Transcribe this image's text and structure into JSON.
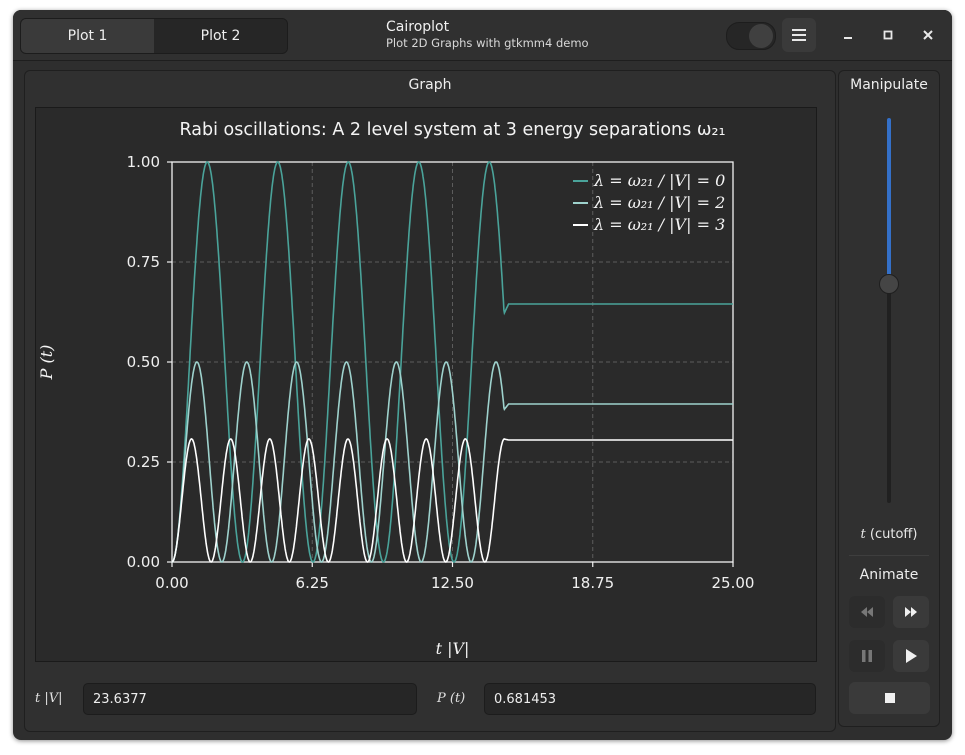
{
  "header": {
    "tabs": [
      {
        "label": "Plot 1"
      },
      {
        "label": "Plot 2"
      }
    ],
    "app_title": "Cairoplot",
    "app_subtitle": "Plot 2D Graphs with gtkmm4 demo"
  },
  "graph_panel": {
    "title": "Graph"
  },
  "chart_data": {
    "type": "line",
    "title": "Rabi oscillations: A 2 level system at 3 energy separations ω₂₁",
    "xlabel": "t |V|",
    "ylabel": "P (t)",
    "xlim": [
      0,
      25
    ],
    "ylim": [
      0,
      1
    ],
    "x_ticks": [
      "0.00",
      "6.25",
      "12.50",
      "18.75",
      "25.00"
    ],
    "y_ticks": [
      "0.00",
      "0.25",
      "0.50",
      "0.75",
      "1.00"
    ],
    "grid": true,
    "cutoff_t": 14.8,
    "legend_position": "top-right",
    "series": [
      {
        "name": "λ = ω₂₁ / |V| = 0",
        "lambda": 0,
        "color": "#4aa39a",
        "final_value": 0.645
      },
      {
        "name": "λ = ω₂₁ / |V| = 2",
        "lambda": 2,
        "color": "#9ed2cd",
        "final_value": 0.395
      },
      {
        "name": "λ = ω₂₁ / |V| = 3",
        "lambda": 3,
        "color": "#ffffff",
        "final_value": 0.305
      }
    ]
  },
  "readouts": {
    "x_label": "t |V|",
    "x_value": "23.6377",
    "y_label": "P (t)",
    "y_value": "0.681453"
  },
  "sidebar": {
    "title": "Manipulate",
    "slider_value": 0.57,
    "cutoff_label_italic": "t",
    "cutoff_label_rest": " (cutoff)",
    "animate_label": "Animate"
  },
  "icons": {
    "menu": "hamburger-icon",
    "minimize": "minimize-icon",
    "maximize": "maximize-icon",
    "close": "close-icon",
    "rewind": "rewind-icon",
    "fast_forward": "fast-forward-icon",
    "pause": "pause-icon",
    "play": "play-icon",
    "stop": "stop-icon"
  },
  "colors": {
    "accent": "#3470c8",
    "background": "#2e2e2e"
  }
}
